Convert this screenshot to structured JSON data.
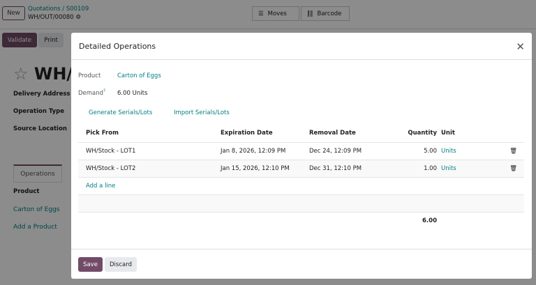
{
  "header": {
    "new_label": "New",
    "breadcrumb_parent": "Quotations",
    "breadcrumb_sep": "/",
    "breadcrumb_order": "S00109",
    "record": "WH/OUT/00080",
    "moves_label": "Moves",
    "barcode_label": "Barcode"
  },
  "actions": {
    "validate_label": "Validate",
    "print_label": "Print"
  },
  "form": {
    "title": "WH/OUT/00080",
    "delivery_address_label": "Delivery Address",
    "operation_type_label": "Operation Type",
    "source_location_label": "Source Location",
    "tabs": [
      {
        "label": "Operations"
      }
    ],
    "product_header": "Product",
    "product_value": "Carton of Eggs",
    "add_product_label": "Add a Product"
  },
  "dialog": {
    "title": "Detailed Operations",
    "product_label": "Product",
    "product_value": "Carton of Eggs",
    "demand_label": "Demand",
    "demand_help": "?",
    "demand_value": "6.00",
    "demand_unit": "Units",
    "generate_label": "Generate Serials/Lots",
    "import_label": "Import Serials/Lots",
    "columns": [
      "Pick From",
      "Expiration Date",
      "Removal Date",
      "Quantity",
      "Unit"
    ],
    "rows": [
      {
        "pick_from": "WH/Stock - LOT1",
        "expiration": "Jan 8, 2026, 12:09 PM",
        "removal": "Dec 24, 12:09 PM",
        "quantity": "5.00",
        "unit": "Units"
      },
      {
        "pick_from": "WH/Stock - LOT2",
        "expiration": "Jan 15, 2026, 12:10 PM",
        "removal": "Dec 31, 12:10 PM",
        "quantity": "1.00",
        "unit": "Units"
      }
    ],
    "add_line_label": "Add a line",
    "total_quantity": "6.00",
    "save_label": "Save",
    "discard_label": "Discard"
  },
  "colors": {
    "primary": "#714b67",
    "link": "#017e84"
  }
}
